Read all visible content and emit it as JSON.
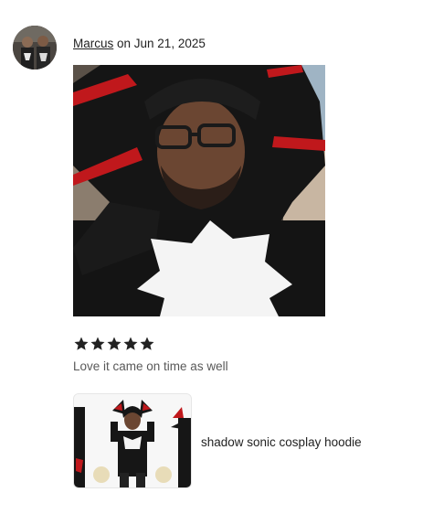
{
  "review": {
    "reviewer_name": "Marcus",
    "date_text": " on Jun 21, 2025",
    "rating": 5,
    "max_rating": 5,
    "text": "Love it came on time as well"
  },
  "product": {
    "title": "shadow sonic cosplay hoodie"
  },
  "colors": {
    "star": "#222222",
    "hoodie_black": "#141414",
    "hoodie_red": "#c0181c",
    "chest_white": "#f4f4f4"
  },
  "icons": {
    "star": "star-icon"
  }
}
